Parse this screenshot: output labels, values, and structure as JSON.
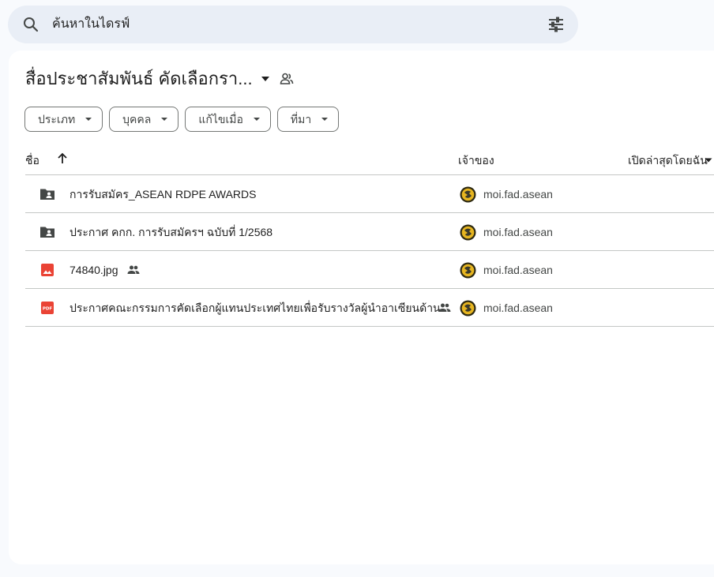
{
  "search": {
    "placeholder": "ค้นหาในไดรฟ์"
  },
  "folder": {
    "title": "สื่อประชาสัมพันธ์ คัดเลือกรา..."
  },
  "filters": [
    {
      "label": "ประเภท"
    },
    {
      "label": "บุคคล"
    },
    {
      "label": "แก้ไขเมื่อ"
    },
    {
      "label": "ที่มา"
    }
  ],
  "columns": {
    "name": "ชื่อ",
    "owner": "เจ้าของ",
    "opened": "เปิดล่าสุดโดยฉัน"
  },
  "files": [
    {
      "name": "การรับสมัคร_ASEAN RDPE AWARDS",
      "icon": "shared-folder-icon",
      "shared": false,
      "owner": "moi.fad.asean"
    },
    {
      "name": "ประกาศ คกก. การรับสมัครฯ ฉบับที่ 1/2568",
      "icon": "shared-folder-icon",
      "shared": false,
      "owner": "moi.fad.asean"
    },
    {
      "name": "74840.jpg",
      "icon": "image-file-icon",
      "shared": true,
      "owner": "moi.fad.asean"
    },
    {
      "name": "ประกาศคณะกรรมการคัดเลือกผู้แทนประเทศไทยเพื่อรับรางวัลผู้นำอาเซียนด้าน...",
      "icon": "pdf-file-icon",
      "shared": true,
      "owner": "moi.fad.asean"
    }
  ],
  "colors": {
    "search_bg": "#e9eef6",
    "page_bg": "#f8fafd",
    "pdf_red": "#ea4335",
    "folder_gray": "#444746",
    "divider": "#c4c7c5"
  }
}
